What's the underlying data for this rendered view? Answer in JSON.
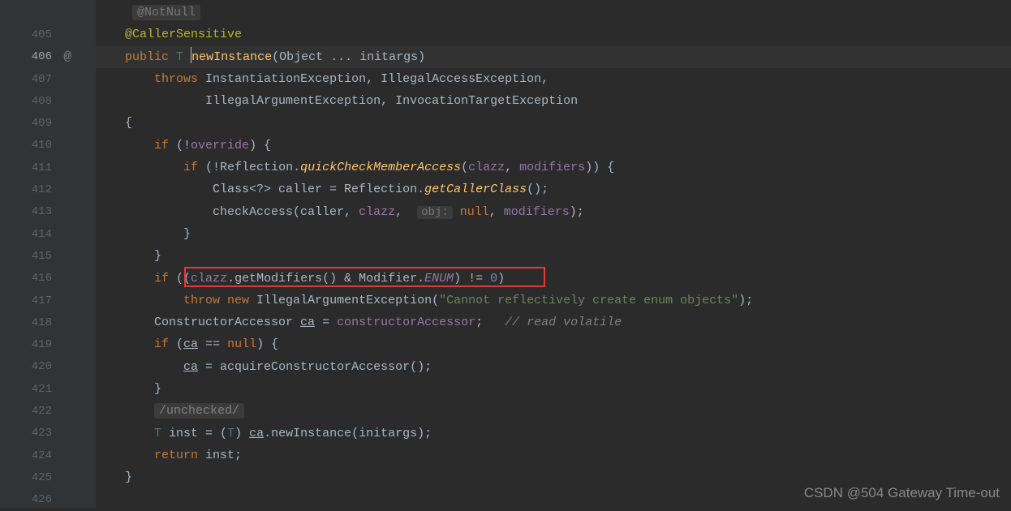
{
  "lines": {
    "start": 405,
    "end": 426,
    "active": 406
  },
  "code": {
    "l405_annot": "@NotNull",
    "l406_annot": "@CallerSensitive",
    "l406_public": "public",
    "l406_T": "T",
    "l406_method": "newInstance",
    "l406_sig": "(Object ... initargs)",
    "l407_throws": "throws",
    "l407_ex": "InstantiationException, IllegalAccessException,",
    "l408_ex": "IllegalArgumentException, InvocationTargetException",
    "l409": "{",
    "l410_if": "if",
    "l410_cond_open": " (!",
    "l410_field": "override",
    "l410_cond_close": ") {",
    "l411_if": "if",
    "l411_open": " (!Reflection.",
    "l411_method": "quickCheckMemberAccess",
    "l411_open2": "(",
    "l411_clazz": "clazz",
    "l411_mid": ", ",
    "l411_mod": "modifiers",
    "l411_close": ")) {",
    "l412_text1": "Class<?> caller = Reflection.",
    "l412_method": "getCallerClass",
    "l412_text2": "();",
    "l413_text1": "checkAccess(caller, ",
    "l413_clazz": "clazz",
    "l413_mid": ", ",
    "l413_hint": "obj:",
    "l413_null": "null",
    "l413_mid2": ", ",
    "l413_mod": "modifiers",
    "l413_close": ");",
    "l414": "}",
    "l415": "}",
    "l416_if": "if",
    "l416_open": " ((",
    "l416_clazz": "clazz",
    "l416_text1": ".getModifiers() & Modifier.",
    "l416_enum": "ENUM",
    "l416_text2": ") != ",
    "l416_zero": "0",
    "l416_close": ")",
    "l417_throw": "throw new",
    "l417_exc": " IllegalArgumentException(",
    "l417_str": "\"Cannot reflectively create enum objects\"",
    "l417_close": ");",
    "l418_text1": "ConstructorAccessor ",
    "l418_ca": "ca",
    "l418_text2": " = ",
    "l418_field": "constructorAccessor",
    "l418_text3": ";   ",
    "l418_comment": "// read volatile",
    "l419_if": "if",
    "l419_open": " (",
    "l419_ca": "ca",
    "l419_text": " == ",
    "l419_null": "null",
    "l419_close": ") {",
    "l420_ca": "ca",
    "l420_text": " = acquireConstructorAccessor();",
    "l421": "}",
    "l422_comment": "/unchecked/",
    "l423_T": "T",
    "l423_text1": " inst = (",
    "l423_T2": "T",
    "l423_text2": ") ",
    "l423_ca": "ca",
    "l423_text3": ".newInstance(initargs);",
    "l424_return": "return",
    "l424_text": " inst;",
    "l425": "}"
  },
  "watermark": "CSDN @504 Gateway Time-out",
  "at_icon": "@"
}
